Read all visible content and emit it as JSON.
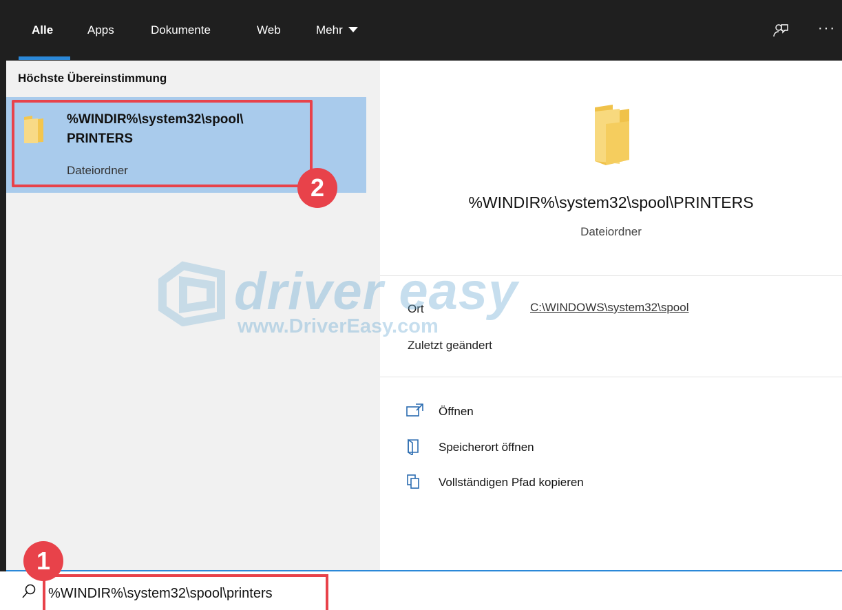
{
  "tabs": [
    {
      "label": "Alle",
      "active": true
    },
    {
      "label": "Apps",
      "active": false
    },
    {
      "label": "Dokumente",
      "active": false
    },
    {
      "label": "Web",
      "active": false
    },
    {
      "label": "Mehr",
      "active": false
    }
  ],
  "topbar": {
    "feedback_icon": "feedback-icon",
    "more_icon": "ellipsis-icon",
    "more_glyph": "···"
  },
  "left": {
    "section_label": "Höchste Übereinstimmung",
    "result": {
      "title_line1": "%WINDIR%\\system32\\spool\\",
      "title_line2": "PRINTERS",
      "subtitle": "Dateiordner",
      "icon": "folder-icon"
    }
  },
  "preview": {
    "title": "%WINDIR%\\system32\\spool\\PRINTERS",
    "subtitle": "Dateiordner",
    "icon": "folder-icon",
    "meta": {
      "location_label": "Ort",
      "location_value": "C:\\WINDOWS\\system32\\spool",
      "modified_label": "Zuletzt geändert"
    },
    "actions": [
      {
        "label": "Öffnen",
        "icon": "open-icon"
      },
      {
        "label": "Speicherort öffnen",
        "icon": "open-location-icon"
      },
      {
        "label": "Vollständigen Pfad kopieren",
        "icon": "copy-icon"
      }
    ]
  },
  "search": {
    "value": "%WINDIR%\\system32\\spool\\printers",
    "icon": "search-icon"
  },
  "badges": {
    "step1": "1",
    "step2": "2"
  },
  "watermark": {
    "brand": "driver easy",
    "url": "www.DriverEasy.com"
  },
  "colors": {
    "topbar_bg": "#1f1f1f",
    "accent": "#2b88d8",
    "selection": "#a9cbec",
    "annotation_red": "#e8424a",
    "folder_yellow": "#f5d27a"
  }
}
